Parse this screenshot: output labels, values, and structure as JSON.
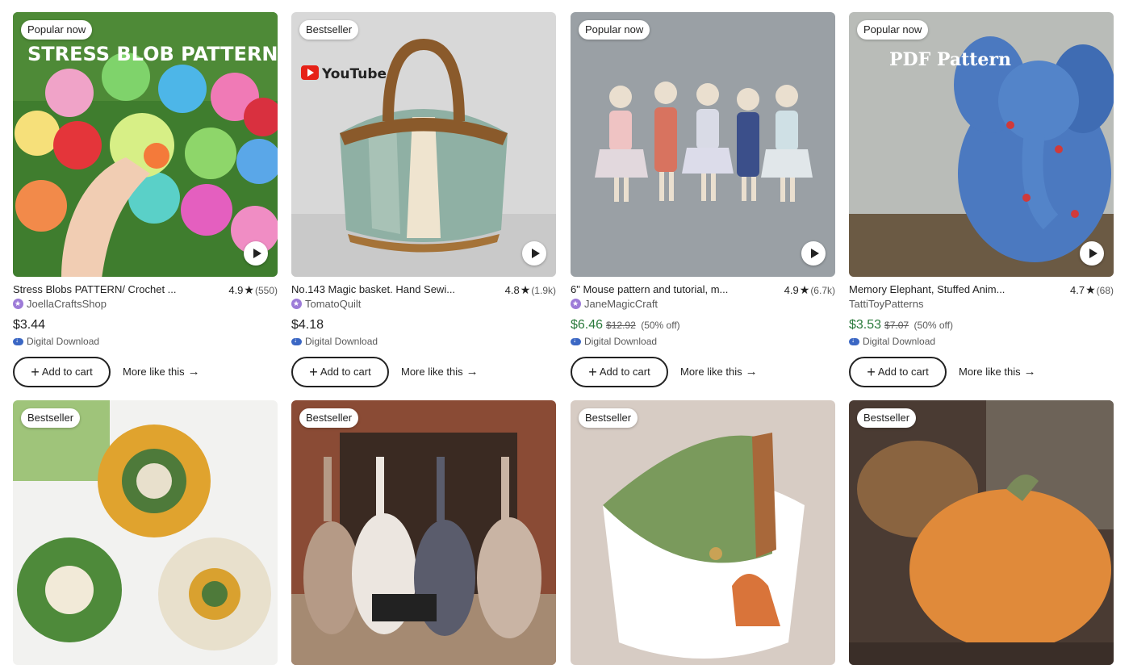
{
  "listings": [
    {
      "badge": "Popular now",
      "title": "Stress Blobs PATTERN/ Crochet ...",
      "rating": "4.9",
      "reviews": "(550)",
      "shop": "JoellaCraftsShop",
      "star_seller": true,
      "price": "$3.44",
      "sale": false,
      "original_price": "",
      "discount": "",
      "delivery": "Digital Download",
      "has_video": true,
      "image_text": "STRESS BLOB PATTERN"
    },
    {
      "badge": "Bestseller",
      "title": "No.143 Magic basket. Hand Sewi...",
      "rating": "4.8",
      "reviews": "(1.9k)",
      "shop": "TomatoQuilt",
      "star_seller": true,
      "price": "$4.18",
      "sale": false,
      "original_price": "",
      "discount": "",
      "delivery": "Digital Download",
      "has_video": true,
      "image_text": "YouTube"
    },
    {
      "badge": "Popular now",
      "title": "6\" Mouse pattern and tutorial, m...",
      "rating": "4.9",
      "reviews": "(6.7k)",
      "shop": "JaneMagicCraft",
      "star_seller": true,
      "price": "$6.46",
      "sale": true,
      "original_price": "$12.92",
      "discount": "(50% off)",
      "delivery": "Digital Download",
      "has_video": true,
      "image_text": ""
    },
    {
      "badge": "Popular now",
      "title": "Memory Elephant, Stuffed Anim...",
      "rating": "4.7",
      "reviews": "(68)",
      "shop": "TattiToyPatterns",
      "star_seller": false,
      "price": "$3.53",
      "sale": true,
      "original_price": "$7.07",
      "discount": "(50% off)",
      "delivery": "Digital Download",
      "has_video": true,
      "image_text": "PDF Pattern"
    },
    {
      "badge": "Bestseller"
    },
    {
      "badge": "Bestseller"
    },
    {
      "badge": "Bestseller"
    },
    {
      "badge": "Bestseller"
    }
  ],
  "labels": {
    "add_to_cart": "Add to cart",
    "more_like_this": "More like this"
  },
  "icons": {
    "star": "star-icon",
    "play": "play-icon",
    "plus": "plus-icon",
    "arrow": "arrow-right-icon",
    "download": "cloud-download-icon"
  },
  "colors": {
    "sale_price": "#2a7a3b",
    "star_seller": "#9d7bd8",
    "download_icon": "#3b67c4"
  }
}
